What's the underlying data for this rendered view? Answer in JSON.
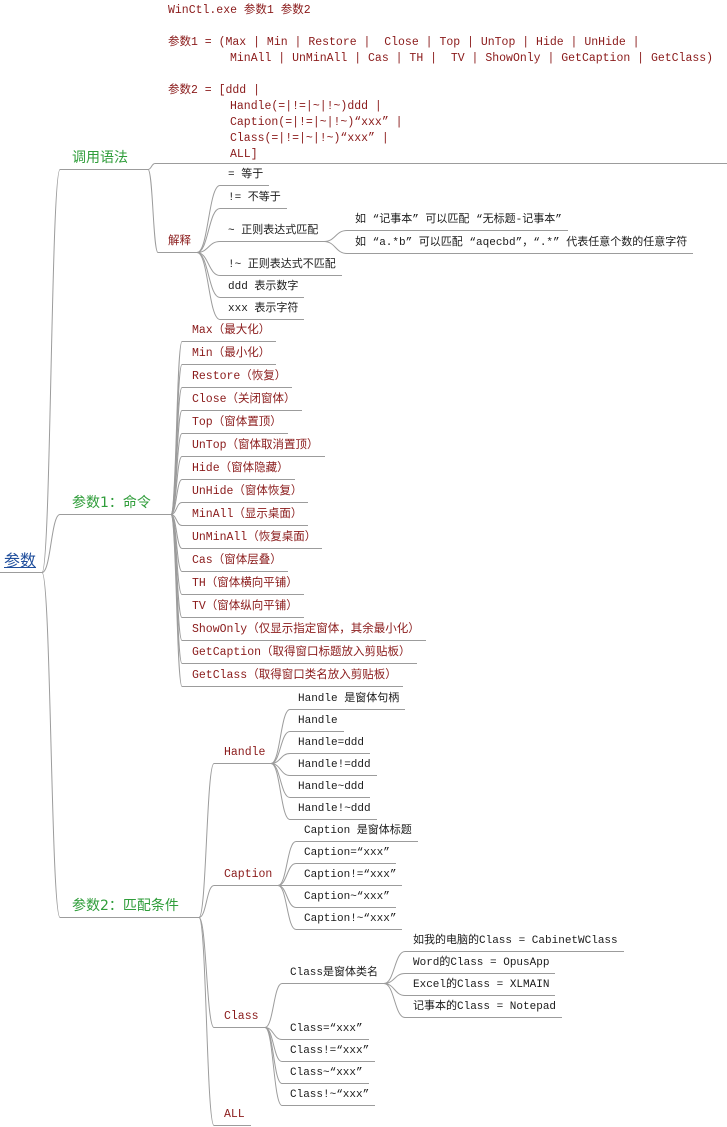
{
  "root": {
    "label": "参数"
  },
  "syntax": {
    "label": "调用语法",
    "lines": [
      "WinCtl.exe 参数1 参数2",
      "参数1 = (Max | Min | Restore |  Close | Top | UnTop | Hide | UnHide |",
      "MinAll | UnMinAll | Cas | TH |  TV | ShowOnly | GetCaption | GetClass)",
      "参数2 = [ddd |",
      "Handle(=|!=|~|!~)ddd |",
      "Caption(=|!=|~|!~)“xxx” |",
      "Class(=|!=|~|!~)“xxx” |",
      "ALL]"
    ],
    "explain": {
      "label": "解释",
      "items": [
        "= 等于",
        "!= 不等于",
        "~ 正则表达式匹配",
        "!~ 正则表达式不匹配",
        "ddd 表示数字",
        "xxx 表示字符"
      ],
      "regex_examples": [
        "如 “记事本” 可以匹配 “无标题-记事本”",
        "如 “a.*b” 可以匹配 “aqecbd”，“.*” 代表任意个数的任意字符"
      ]
    }
  },
  "param1": {
    "label": "参数1：命令",
    "commands": [
      "Max（最大化）",
      "Min（最小化）",
      "Restore（恢复）",
      "Close（关闭窗体）",
      "Top（窗体置顶）",
      "UnTop（窗体取消置顶）",
      "Hide（窗体隐藏）",
      "UnHide（窗体恢复）",
      "MinAll（显示桌面）",
      "UnMinAll（恢复桌面）",
      "Cas（窗体层叠）",
      "TH（窗体横向平铺）",
      "TV（窗体纵向平铺）",
      "ShowOnly（仅显示指定窗体，其余最小化）",
      "GetCaption（取得窗口标题放入剪贴板）",
      "GetClass（取得窗口类名放入剪贴板）"
    ]
  },
  "param2": {
    "label": "参数2：匹配条件",
    "handle": {
      "label": "Handle",
      "items": [
        "Handle 是窗体句柄",
        "Handle",
        "Handle=ddd",
        "Handle!=ddd",
        "Handle~ddd",
        "Handle!~ddd"
      ]
    },
    "caption": {
      "label": "Caption",
      "items": [
        "Caption 是窗体标题",
        "Caption=“xxx”",
        "Caption!=“xxx”",
        "Caption~“xxx”",
        "Caption!~“xxx”"
      ]
    },
    "class": {
      "label": "Class",
      "desc": {
        "label": "Class是窗体类名",
        "examples": [
          "如我的电脑的Class = CabinetWClass",
          "Word的Class = OpusApp",
          "Excel的Class = XLMAIN",
          "记事本的Class = Notepad"
        ]
      },
      "items": [
        "Class=“xxx”",
        "Class!=“xxx”",
        "Class~“xxx”",
        "Class!~“xxx”"
      ]
    },
    "all": {
      "label": "ALL"
    }
  },
  "colors": {
    "root": "#1f4e9c",
    "branch": "#2f9d3a",
    "command": "#8a1a1a",
    "text": "#1a1a1a",
    "line": "#9c9c9c"
  }
}
